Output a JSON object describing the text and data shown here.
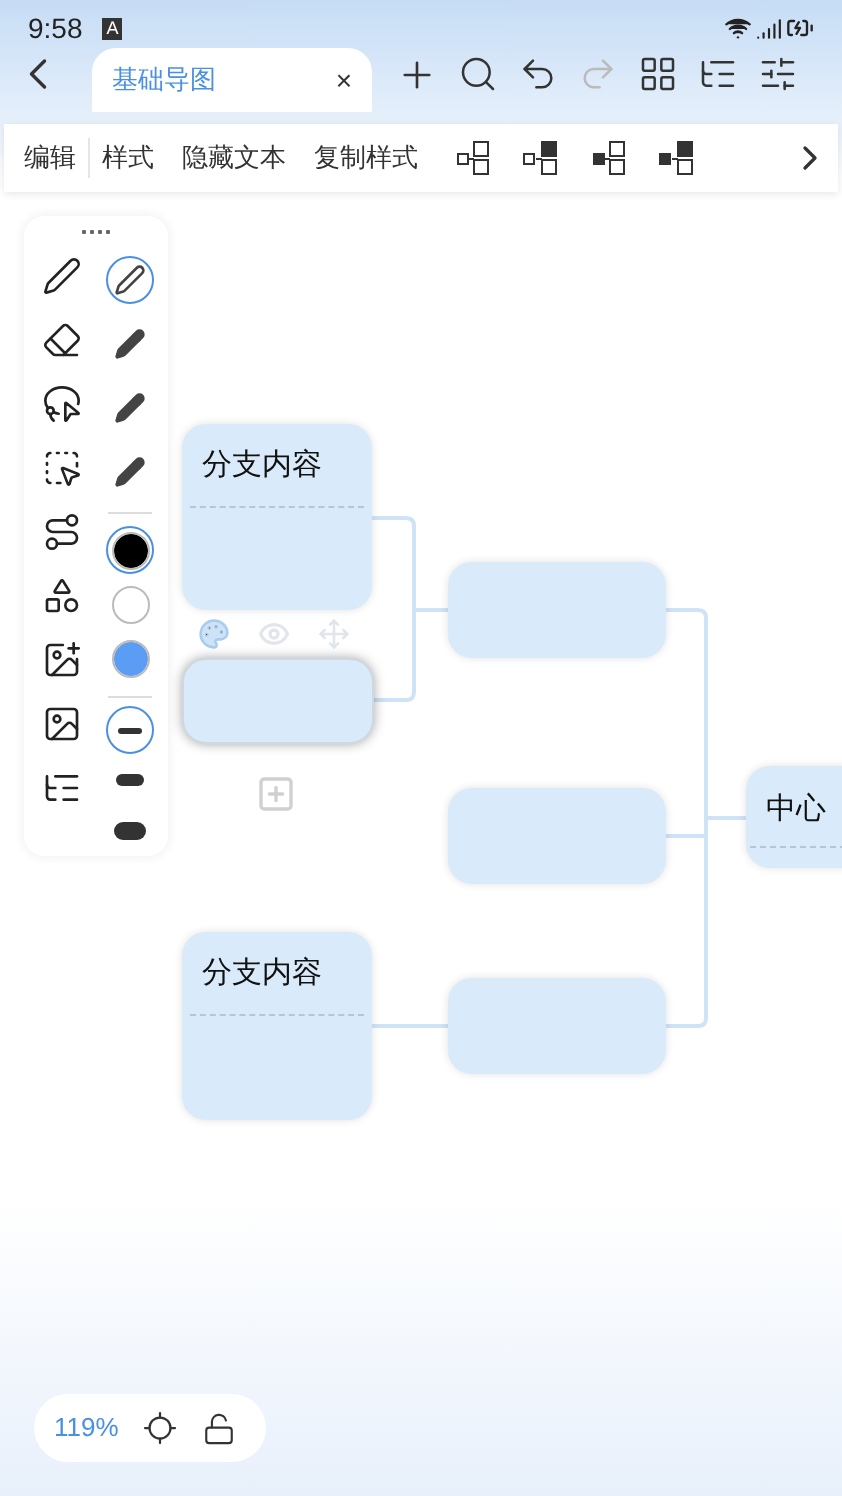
{
  "status_bar": {
    "time": "9:58",
    "badge": "A"
  },
  "tab": {
    "title": "基础导图",
    "close": "×",
    "selected": true
  },
  "toolbar": {
    "items": [
      "编辑",
      "样式",
      "隐藏文本",
      "复制样式"
    ]
  },
  "pen_panel": {
    "pens": [
      {
        "selected": true
      },
      {
        "selected": false
      },
      {
        "selected": false
      },
      {
        "selected": false
      }
    ],
    "colors": [
      {
        "color": "#000000",
        "selected": true
      },
      {
        "color": "#ffffff",
        "selected": false
      },
      {
        "color": "#5b9cf5",
        "selected": false
      }
    ],
    "widths": [
      {
        "selected": true
      },
      {
        "selected": false
      },
      {
        "selected": false
      }
    ]
  },
  "map": {
    "branches": [
      {
        "text": "分支内容"
      },
      {
        "text": "分支内容"
      }
    ],
    "center": {
      "text": "中心"
    }
  },
  "zoom": {
    "value": "119%"
  }
}
